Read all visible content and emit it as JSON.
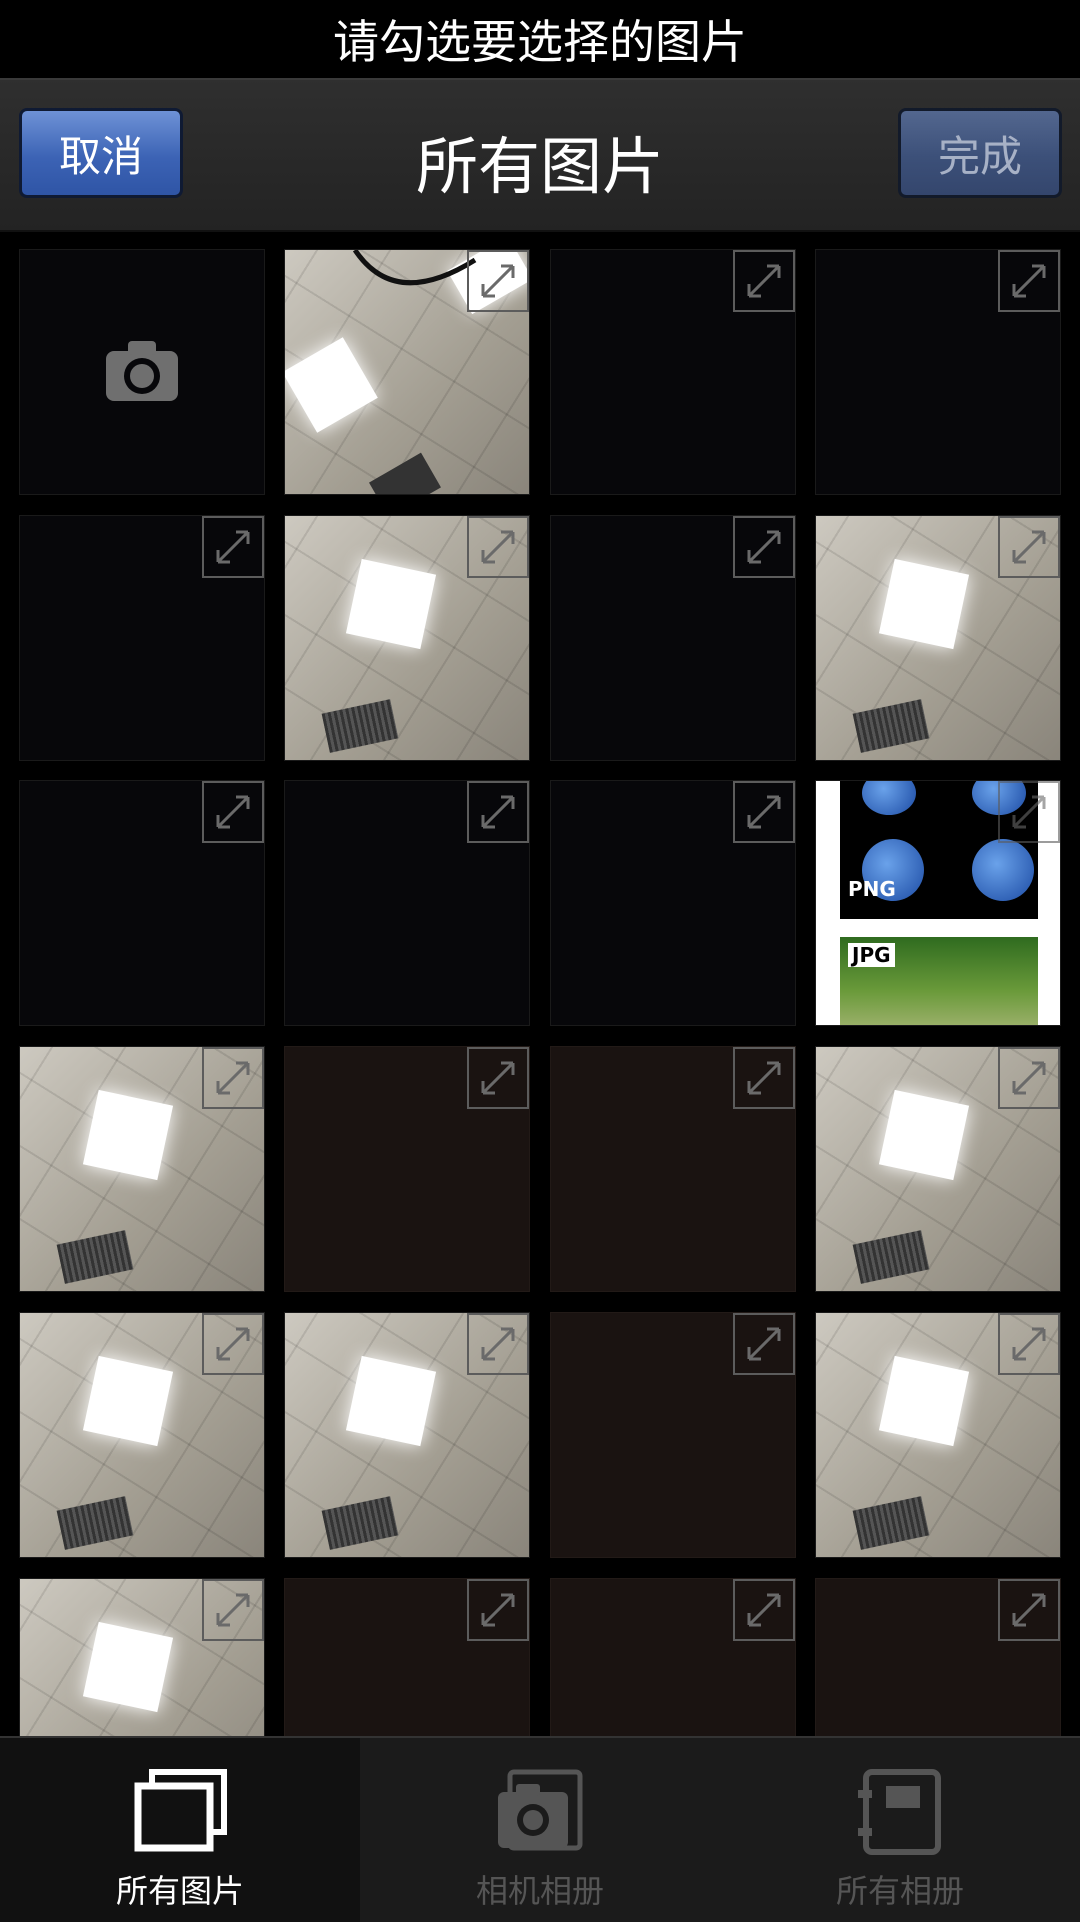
{
  "header": {
    "instruction": "请勾选要选择的图片"
  },
  "navbar": {
    "title": "所有图片",
    "cancel_label": "取消",
    "done_label": "完成"
  },
  "grid": {
    "thumbnails": [
      {
        "type": "camera"
      },
      {
        "type": "ceiling-corner"
      },
      {
        "type": "dark"
      },
      {
        "type": "dark"
      },
      {
        "type": "dark"
      },
      {
        "type": "ceiling"
      },
      {
        "type": "dark"
      },
      {
        "type": "ceiling"
      },
      {
        "type": "dark"
      },
      {
        "type": "dark"
      },
      {
        "type": "dark"
      },
      {
        "type": "png-jpg"
      },
      {
        "type": "ceiling"
      },
      {
        "type": "brown"
      },
      {
        "type": "brown"
      },
      {
        "type": "ceiling"
      },
      {
        "type": "ceiling"
      },
      {
        "type": "ceiling"
      },
      {
        "type": "brown"
      },
      {
        "type": "ceiling"
      },
      {
        "type": "ceiling"
      },
      {
        "type": "brown"
      },
      {
        "type": "brown"
      },
      {
        "type": "brown"
      }
    ],
    "sample_labels": {
      "png": "PNG",
      "jpg": "JPG"
    }
  },
  "tabs": [
    {
      "label": "所有图片",
      "icon": "all-photos-icon",
      "active": true
    },
    {
      "label": "相机相册",
      "icon": "camera-album-icon",
      "active": false
    },
    {
      "label": "所有相册",
      "icon": "all-albums-icon",
      "active": false
    }
  ]
}
